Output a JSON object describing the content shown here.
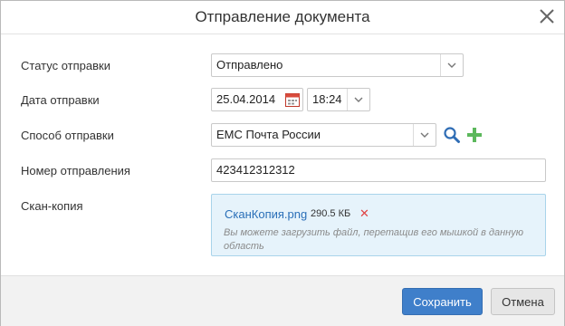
{
  "dialog": {
    "title": "Отправление документа",
    "close_icon": "close-icon"
  },
  "form": {
    "status": {
      "label": "Статус отправки",
      "value": "Отправлено"
    },
    "date": {
      "label": "Дата отправки",
      "date_value": "25.04.2014",
      "time_value": "18:24"
    },
    "method": {
      "label": "Способ отправки",
      "value": "EMC Почта России"
    },
    "number": {
      "label": "Номер отправления",
      "value": "423412312312"
    },
    "scan": {
      "label": "Скан-копия",
      "file_name": "СканКопия.png",
      "file_size": "290.5 КБ",
      "remove_symbol": "✕",
      "hint": "Вы можете загрузить файл, перетащив его мышкой в данную область"
    }
  },
  "footer": {
    "save_label": "Сохранить",
    "cancel_label": "Отмена"
  },
  "colors": {
    "primary": "#3f7fca",
    "link": "#2a6fb8",
    "remove": "#e04343",
    "add": "#5cb85c",
    "upload_bg": "#e6f3fb"
  }
}
